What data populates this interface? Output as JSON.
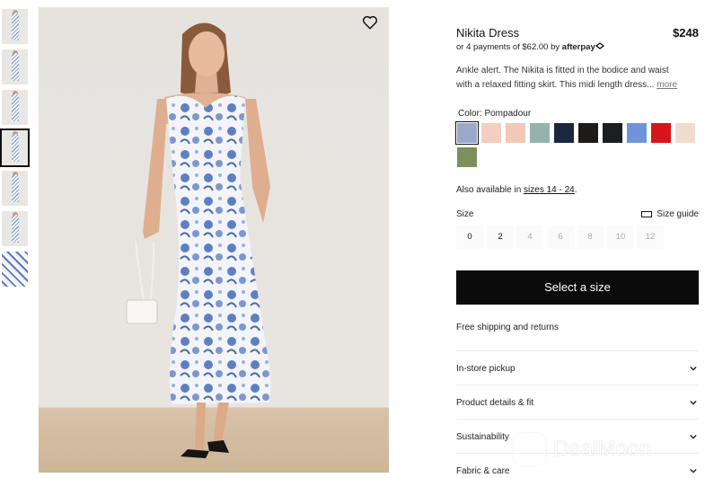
{
  "gallery": {
    "thumbnails": [
      "thumb-1",
      "thumb-2",
      "thumb-3",
      "thumb-4",
      "thumb-5",
      "thumb-6",
      "thumb-7"
    ],
    "active_index": 3,
    "favorite_icon": "heart-outline-icon"
  },
  "product": {
    "name": "Nikita Dress",
    "price": "$248",
    "afterpay_text": "or 4 payments of $62.00 by",
    "afterpay_brand": "afterpay",
    "description_line1": "Ankle alert. The Nikita is fitted in the bodice and waist",
    "description_line2": "with a relaxed fitting skirt. This midi length dress...",
    "more_link": "more"
  },
  "color": {
    "label": "Color: Pompadour",
    "swatches": [
      {
        "name": "Pompadour",
        "color": "#9aa9c9",
        "selected": true
      },
      {
        "name": "swatch-2",
        "color": "#f3cfc2"
      },
      {
        "name": "swatch-3",
        "color": "#f2c9b7"
      },
      {
        "name": "swatch-4",
        "color": "#95b3ab"
      },
      {
        "name": "swatch-5",
        "color": "#1b2640"
      },
      {
        "name": "swatch-6",
        "color": "#1e1b18"
      },
      {
        "name": "swatch-7",
        "color": "#1c1e22"
      },
      {
        "name": "swatch-8",
        "color": "#6f95d8"
      },
      {
        "name": "swatch-9",
        "color": "#d7161b"
      },
      {
        "name": "swatch-10",
        "color": "#f0dccf"
      },
      {
        "name": "swatch-11",
        "color": "#7d8f5c"
      }
    ]
  },
  "availability": {
    "prefix": "Also available in ",
    "link": "sizes 14 - 24",
    "suffix": "."
  },
  "size": {
    "label": "Size",
    "guide_label": "Size guide",
    "options": [
      {
        "label": "0",
        "available": true
      },
      {
        "label": "2",
        "available": true
      },
      {
        "label": "4",
        "available": false
      },
      {
        "label": "6",
        "available": false
      },
      {
        "label": "8",
        "available": false
      },
      {
        "label": "10",
        "available": false
      },
      {
        "label": "12",
        "available": false
      }
    ]
  },
  "cta": {
    "label": "Select a size"
  },
  "shipping": {
    "text": "Free shipping and returns"
  },
  "accordions": [
    {
      "label": "In-store pickup"
    },
    {
      "label": "Product details & fit"
    },
    {
      "label": "Sustainability"
    },
    {
      "label": "Fabric & care"
    }
  ],
  "watermark": {
    "text": "DealMoon"
  }
}
